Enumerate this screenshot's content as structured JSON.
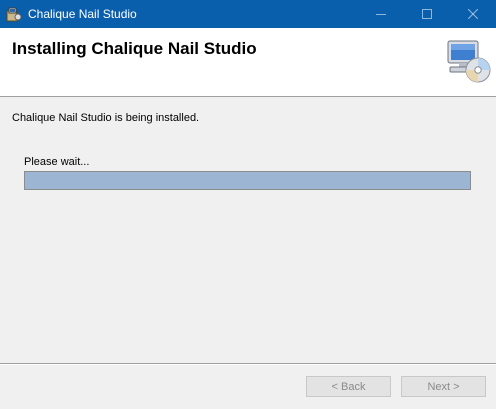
{
  "window": {
    "title": "Chalique Nail Studio",
    "app_icon": "installer-icon",
    "controls": [
      "minimize-icon",
      "maximize-icon",
      "close-icon"
    ]
  },
  "header": {
    "title": "Installing Chalique Nail Studio",
    "icon": "computer-cd-icon"
  },
  "main": {
    "status_text": "Chalique Nail Studio is being installed.",
    "wait_label": "Please wait...",
    "progress_fraction": 1.0
  },
  "footer": {
    "back_label": "< Back",
    "next_label": "Next >"
  },
  "colors": {
    "titlebar": "#0a5fad",
    "progress_fill": "#9bb5d3",
    "background": "#f0f0f0"
  }
}
